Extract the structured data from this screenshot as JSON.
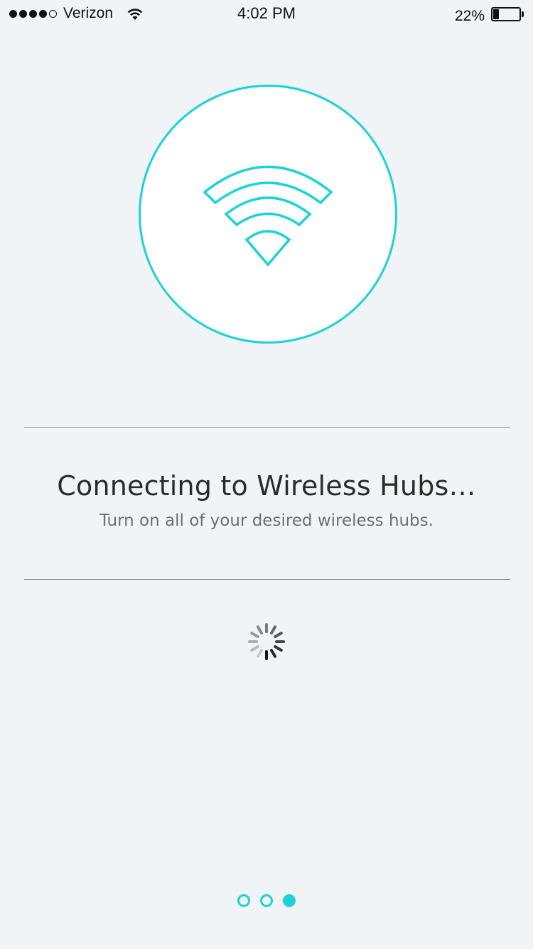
{
  "status_bar": {
    "carrier": "Verizon",
    "time": "4:02 PM",
    "battery_percent": "22%",
    "battery_level": 0.22,
    "signal_bars_filled": 4,
    "signal_bars_total": 5
  },
  "hero": {
    "icon": "wifi-icon",
    "accent_color": "#1bd3d6"
  },
  "content": {
    "title": "Connecting to Wireless Hubs…",
    "subtitle": "Turn on all of your desired wireless hubs."
  },
  "loading": {
    "icon": "spinner-icon"
  },
  "pager": {
    "total_pages": 3,
    "current_page": 3
  }
}
